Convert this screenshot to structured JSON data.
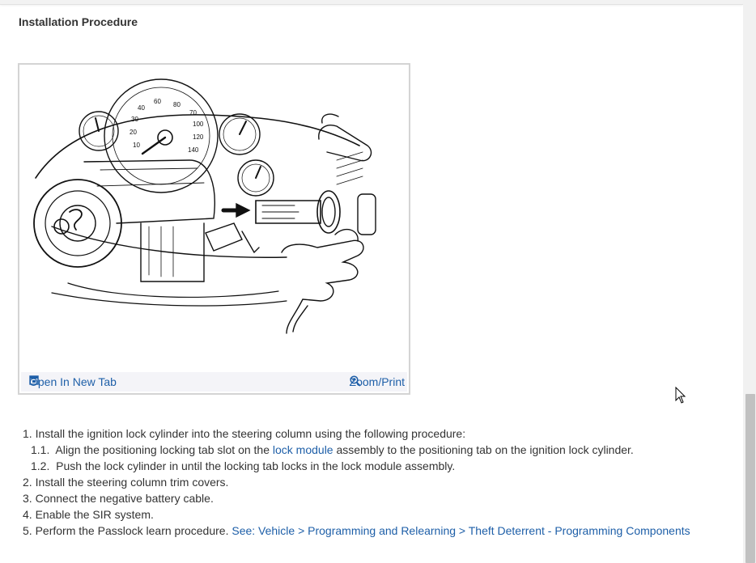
{
  "section": {
    "title": "Installation Procedure"
  },
  "figure": {
    "open_label": "Open In New Tab",
    "zoom_label": "Zoom/Print",
    "gauge_labels": [
      "60",
      "40",
      "80",
      "70",
      "30",
      "100",
      "20",
      "120",
      "10",
      "140"
    ]
  },
  "steps": {
    "s1_num": "1.",
    "s1_text": "Install the ignition lock cylinder into the steering column using the following procedure:",
    "s1_1_num": "1.1.",
    "s1_1_before": "Align the positioning locking tab slot on the ",
    "s1_1_link": "lock module",
    "s1_1_after": " assembly to the positioning tab on the ignition lock cylinder.",
    "s1_2_num": "1.2.",
    "s1_2_text": "Push the lock cylinder in until the locking tab locks in the lock module assembly.",
    "s2_num": "2.",
    "s2_text": "Install the steering column trim covers.",
    "s3_num": "3.",
    "s3_text": "Connect the negative battery cable.",
    "s4_num": "4.",
    "s4_text": "Enable the SIR system.",
    "s5_num": "5.",
    "s5_text": "Perform the Passlock learn procedure.",
    "s5_link": "See: Vehicle > Programming and Relearning > Theft Deterrent - Programming Components"
  },
  "colors": {
    "link": "#1e5fa8",
    "text": "#333333",
    "toolbar_bg": "#f4f4f8",
    "frame_border": "#d4d4d4"
  }
}
